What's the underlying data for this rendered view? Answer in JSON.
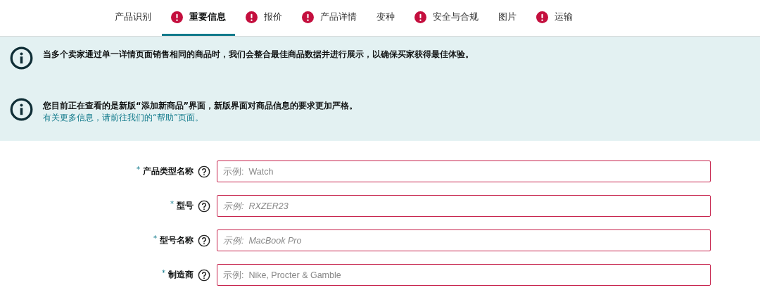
{
  "tabs": [
    {
      "label": "产品识别",
      "warning": false,
      "selected": false
    },
    {
      "label": "重要信息",
      "warning": true,
      "selected": true
    },
    {
      "label": "报价",
      "warning": true,
      "selected": false
    },
    {
      "label": "产品详情",
      "warning": true,
      "selected": false
    },
    {
      "label": "变种",
      "warning": false,
      "selected": false
    },
    {
      "label": "安全与合规",
      "warning": true,
      "selected": false
    },
    {
      "label": "图片",
      "warning": false,
      "selected": false
    },
    {
      "label": "运输",
      "warning": true,
      "selected": false
    }
  ],
  "notices": [
    {
      "text": "当多个卖家通过单一详情页面销售相同的商品时，我们会整合最佳商品数据并进行展示，以确保买家获得最佳体验。"
    },
    {
      "text": "您目前正在查看的是新版“添加新商品”界面，新版界面对商品信息的要求更加严格。",
      "link": "有关更多信息，请前往我们的“帮助”页面。"
    }
  ],
  "fields": [
    {
      "required_mark": "*",
      "label": "产品类型名称",
      "placeholder": "示例:  Watch",
      "italic": false,
      "invalid": true
    },
    {
      "required_mark": "*",
      "label": "型号",
      "placeholder": "示例:  RXZER23",
      "italic": true,
      "invalid": true
    },
    {
      "required_mark": "*",
      "label": "型号名称",
      "placeholder": "示例:  MacBook Pro",
      "italic": true,
      "invalid": true
    },
    {
      "required_mark": "*",
      "label": "制造商",
      "placeholder": "示例:  Nike, Procter & Gamble",
      "italic": false,
      "invalid": true
    }
  ]
}
